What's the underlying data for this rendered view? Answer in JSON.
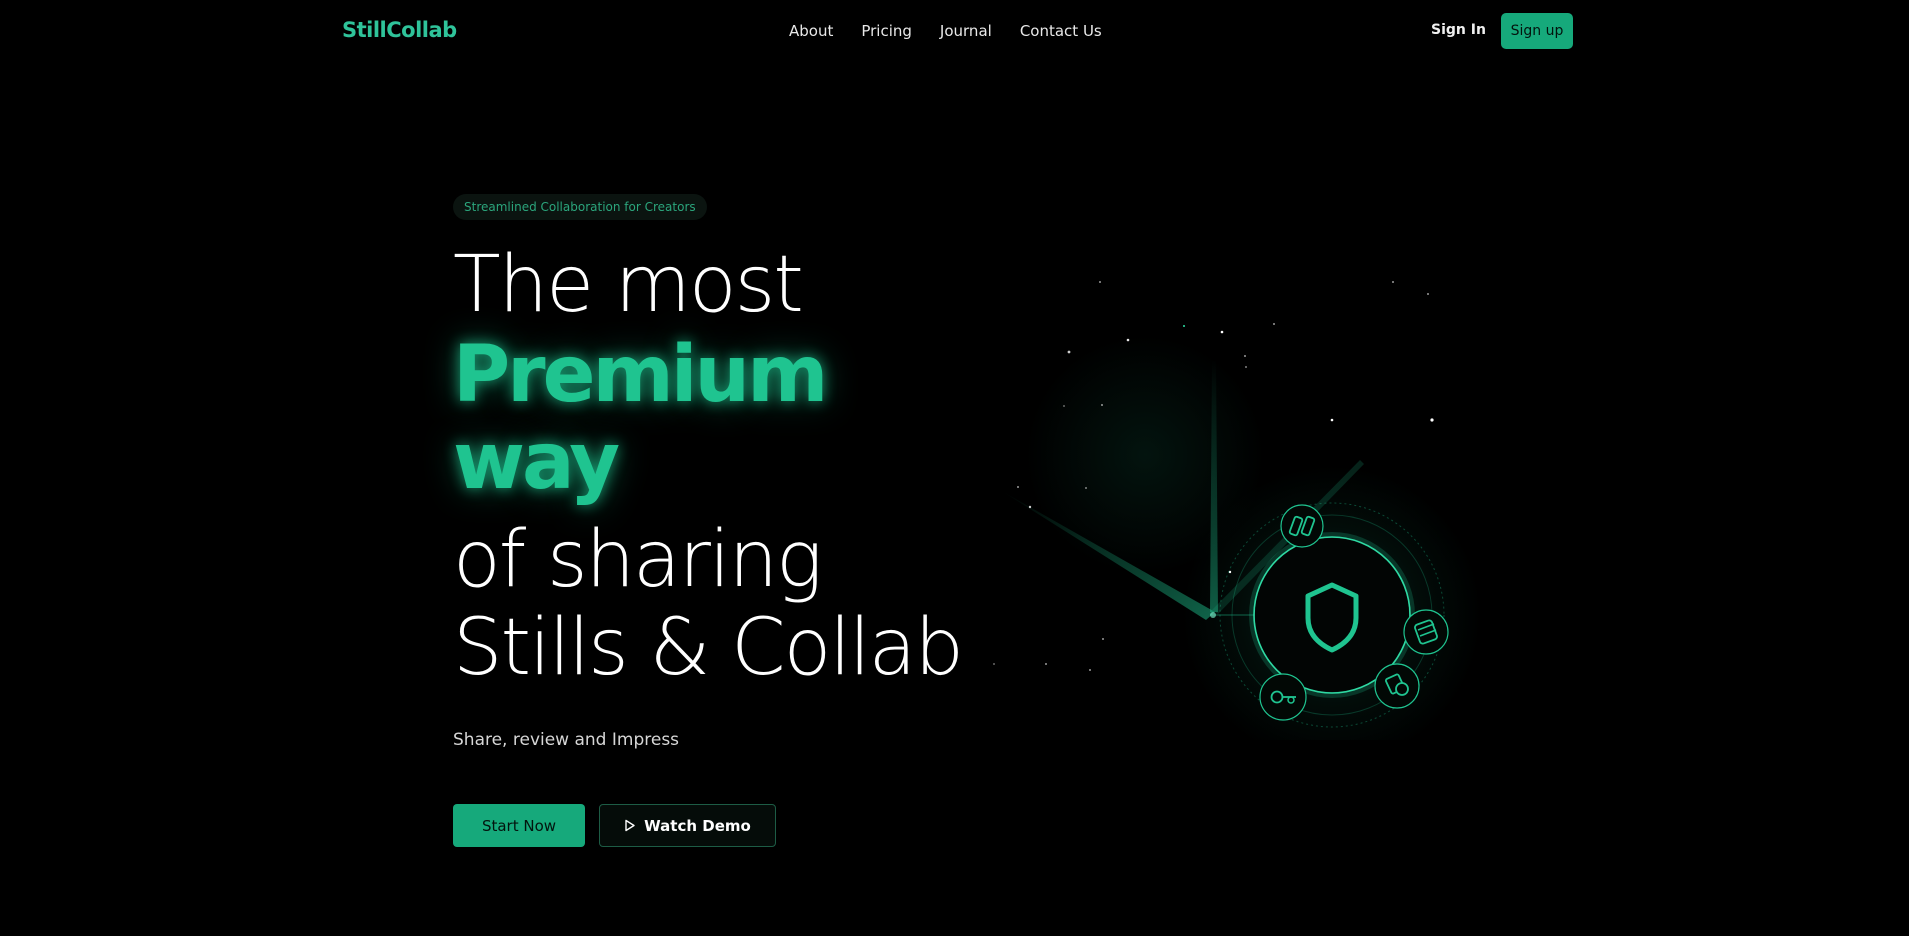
{
  "brand": {
    "name": "StillCollab",
    "accent": "#1fc490",
    "button_color": "#16a97b"
  },
  "nav": {
    "items": [
      "About",
      "Pricing",
      "Journal",
      "Contact Us"
    ]
  },
  "auth": {
    "signin_label": "Sign In",
    "signup_label": "Sign up"
  },
  "hero": {
    "badge": "Streamlined Collaboration for Creators",
    "line1": "The most",
    "line2": "Premium",
    "line3": "way",
    "line4": "of sharing",
    "line5": "Stills & Collab",
    "subtitle": "Share, review and Impress",
    "cta_primary": "Start Now",
    "cta_secondary": "Watch Demo"
  },
  "illustration": {
    "center_icon": "shield-icon",
    "orbit_icons": [
      "columns-icon",
      "stack-icon",
      "tag-icon",
      "key-icon"
    ]
  }
}
